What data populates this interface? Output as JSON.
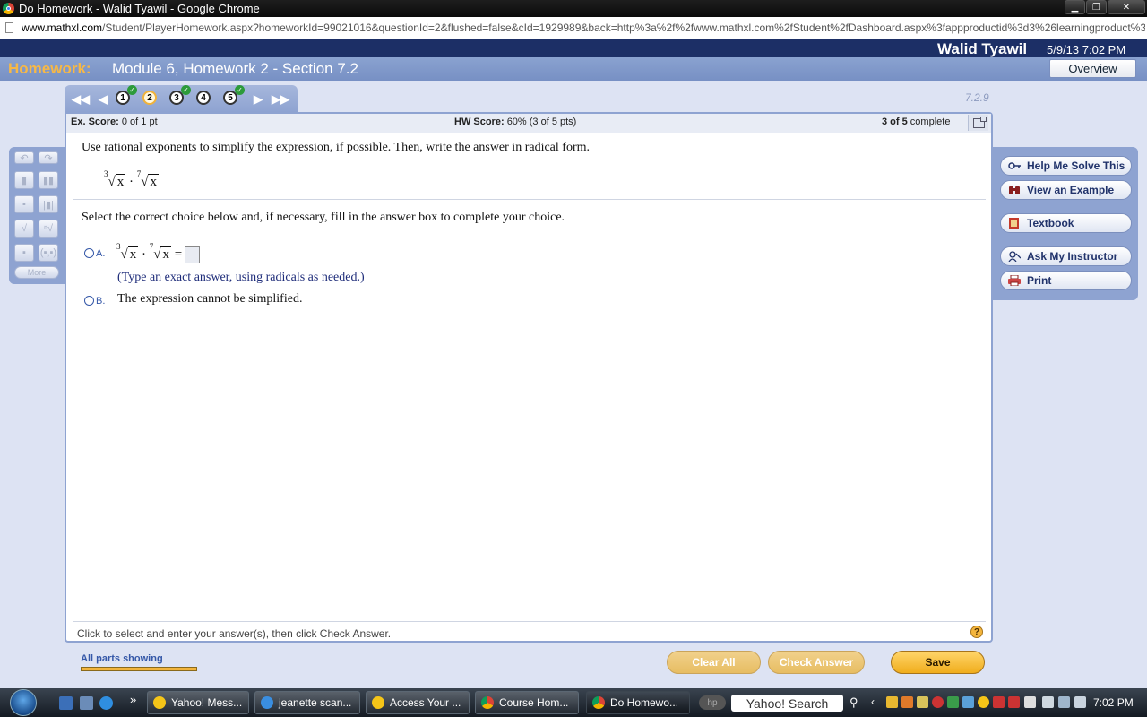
{
  "window": {
    "title": "Do Homework - Walid Tyawil - Google Chrome"
  },
  "address": {
    "host": "www.mathxl.com",
    "path": "/Student/PlayerHomework.aspx?homeworkId=99021016&questionId=2&flushed=false&cId=1929989&back=http%3a%2f%2fwww.mathxl.com%2fStudent%2fDashboard.aspx%3fappproductid%3d3%26learningproduct%3"
  },
  "header": {
    "user": "Walid Tyawil",
    "datetime": "5/9/13 7:02 PM"
  },
  "homework": {
    "label": "Homework:",
    "title": "Module 6, Homework 2 - Section 7.2",
    "overview_label": "Overview"
  },
  "nav": {
    "questions": [
      {
        "num": "1",
        "done": true,
        "current": false
      },
      {
        "num": "2",
        "done": false,
        "current": true
      },
      {
        "num": "3",
        "done": true,
        "current": false
      },
      {
        "num": "4",
        "done": false,
        "current": false
      },
      {
        "num": "5",
        "done": true,
        "current": false
      }
    ],
    "section_id": "7.2.9"
  },
  "score": {
    "ex_label": "Ex. Score:",
    "ex_value": "0 of 1 pt",
    "hw_label": "HW Score:",
    "hw_value": "60% (3 of 5 pts)",
    "complete_count": "3 of 5",
    "complete_label": "complete"
  },
  "question": {
    "prompt": "Use rational exponents to simplify the expression, if possible. Then, write the answer in radical form.",
    "expr": {
      "index1": "3",
      "radicand1": "x",
      "dot": "·",
      "index2": "7",
      "radicand2": "x",
      "equals": "="
    },
    "instruction": "Select the correct choice below and, if necessary, fill in the answer box to complete your choice.",
    "optionA_label": "A.",
    "optionA_hint": "(Type an exact answer, using radicals as needed.)",
    "optionB_label": "B.",
    "optionB_text": "The expression cannot be simplified.",
    "footer_hint": "Click to select and enter your answer(s), then click Check Answer.",
    "help_symbol": "?"
  },
  "palette": {
    "more_label": "More"
  },
  "help": {
    "buttons": [
      "Help Me Solve This",
      "View an Example",
      "Textbook",
      "Ask My Instructor",
      "Print"
    ]
  },
  "actions": {
    "parts_label": "All parts showing",
    "clear_label": "Clear All",
    "check_label": "Check Answer",
    "save_label": "Save"
  },
  "taskbar": {
    "items": [
      "Yahoo! Mess...",
      "jeanette scan...",
      "Access Your ...",
      "Course Hom...",
      "Do Homewo..."
    ],
    "chevron": "»",
    "search_label": "Yahoo! Search",
    "clock": "7:02 PM"
  },
  "colors": {
    "accent": "#1c2f66",
    "homework_orange": "#f6b847",
    "panel_blue": "#8ea3d1"
  }
}
